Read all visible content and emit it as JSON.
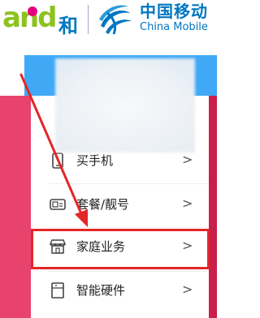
{
  "brand": {
    "and_logo_text": "and",
    "and_logo_suffix": "和",
    "company_name": "中国移动",
    "company_name_en": "China Mobile"
  },
  "menu": {
    "items": [
      {
        "label": "买手机",
        "icon": "phone-icon",
        "visible_label": "买手机"
      },
      {
        "label": "套餐/靓号",
        "icon": "sim-card-icon"
      },
      {
        "label": "家庭业务",
        "icon": "home-store-icon"
      },
      {
        "label": "智能硬件",
        "icon": "device-icon"
      }
    ],
    "arrow_glyph": ">"
  },
  "annotation": {
    "highlighted_item": "家庭业务",
    "color": "#e32626"
  },
  "colors": {
    "pink": "#e8436c",
    "blue": "#3fa9f5",
    "brand_blue": "#0076c0",
    "and_green": "#8dc21f",
    "and_magenta": "#e6007e"
  }
}
